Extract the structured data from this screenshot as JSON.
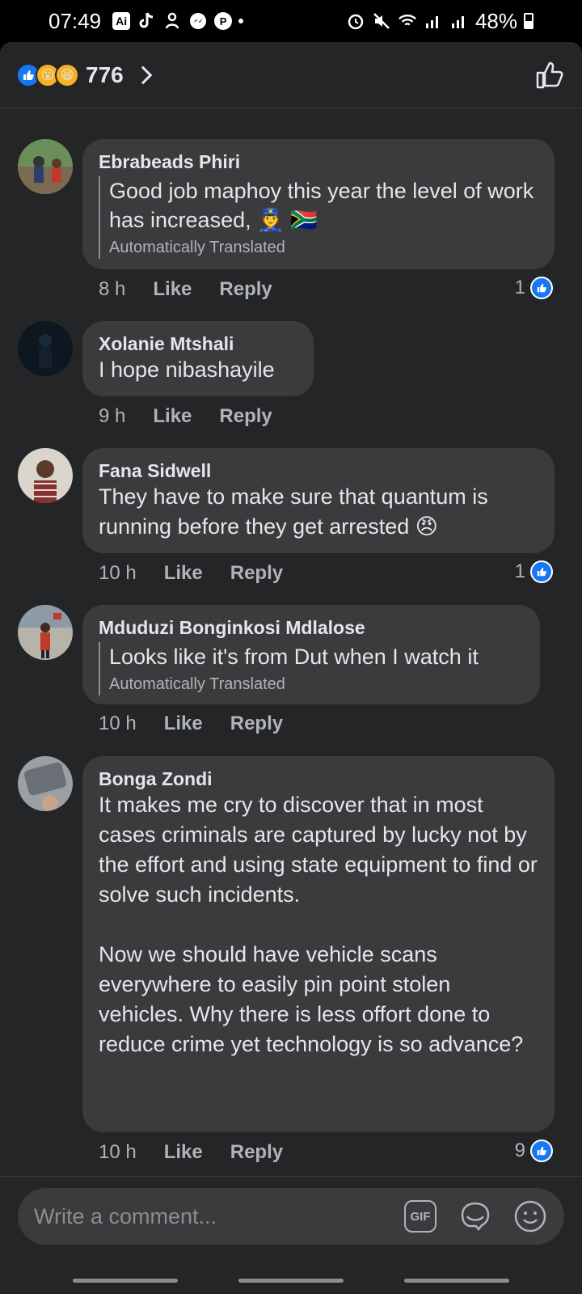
{
  "status_bar": {
    "time": "07:49",
    "ai_badge": "Ai",
    "battery": "48%"
  },
  "header": {
    "reaction_count": "776",
    "reactions": [
      "like-icon",
      "wow-icon",
      "haha-icon"
    ]
  },
  "comments": [
    {
      "author": "Ebrabeads Phiri",
      "text": "Good job maphoy this year the level of work has increased, 👮 🇿🇦",
      "translated_note": "Automatically Translated",
      "time": "8 h",
      "like_label": "Like",
      "reply_label": "Reply",
      "like_count": "1"
    },
    {
      "author": "Xolanie Mtshali",
      "text": "I hope nibashayile",
      "time": "9 h",
      "like_label": "Like",
      "reply_label": "Reply"
    },
    {
      "author": "Fana Sidwell",
      "text": "They have to make sure that quantum is running before they get arrested 😠",
      "time": "10 h",
      "like_label": "Like",
      "reply_label": "Reply",
      "like_count": "1"
    },
    {
      "author": "Mduduzi Bonginkosi Mdlalose",
      "text": "Looks like it's from Dut when I watch it",
      "translated_note": "Automatically Translated",
      "time": "10 h",
      "like_label": "Like",
      "reply_label": "Reply"
    },
    {
      "author": "Bonga Zondi",
      "text": "It makes me cry to discover that in most cases criminals are captured by lucky not by the effort and using state equipment to find or solve such incidents.\n\nNow we should have vehicle scans everywhere to easily pin point stolen vehicles. Why there is less offort done to reduce crime yet technology is so advance?",
      "time": "10 h",
      "like_label": "Like",
      "reply_label": "Reply",
      "like_count": "9"
    }
  ],
  "composer": {
    "placeholder": "Write a comment...",
    "gif_label": "GIF"
  },
  "colors": {
    "background": "#242526",
    "bubble": "#3a3b3c",
    "accent": "#1877f2"
  }
}
